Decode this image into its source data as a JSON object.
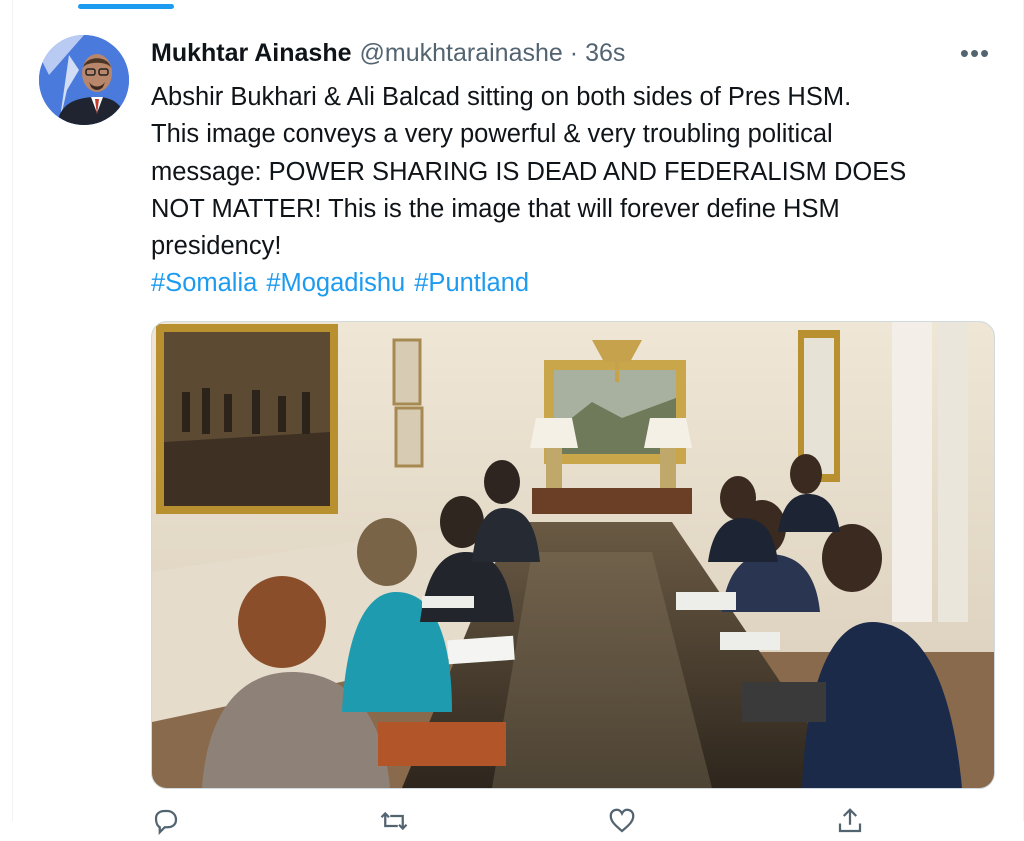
{
  "tweet": {
    "author": {
      "display_name": "Mukhtar Ainashe",
      "handle": "@mukhtarainashe"
    },
    "separator": "·",
    "time": "36s",
    "more_label": "•••",
    "text_lines": [
      "Abshir Bukhari & Ali Balcad sitting on both sides of Pres HSM.",
      "This image conveys a very powerful & very troubling political",
      "message: POWER SHARING IS DEAD AND FEDERALISM DOES",
      "NOT MATTER! This is the image that will forever define HSM",
      "presidency!"
    ],
    "hashtags": [
      "#Somalia",
      "#Mogadishu",
      "#Puntland"
    ]
  },
  "icons": {
    "more": "more-horizontal-icon",
    "reply": "reply-icon",
    "retweet": "retweet-icon",
    "like": "heart-icon",
    "share": "share-icon"
  },
  "colors": {
    "accent": "#1d9bf0",
    "text_primary": "#0f1419",
    "text_secondary": "#536471",
    "border": "#cfd9de"
  }
}
